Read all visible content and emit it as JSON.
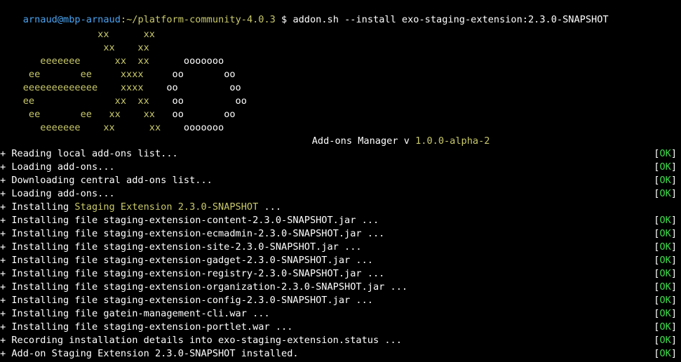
{
  "prompt": {
    "user_host": "arnaud@mbp-arnaud",
    "path": ":~/platform-community-4.0.3",
    "symbol": " $ ",
    "command": "addon.sh --install exo-staging-extension:2.3.0-SNAPSHOT"
  },
  "ascii_art": [
    {
      "e": "                 xx      xx",
      "o": ""
    },
    {
      "e": "                  xx    xx",
      "o": ""
    },
    {
      "e": "       eeeeeee      xx  xx      ",
      "o": "ooooooo"
    },
    {
      "e": "     ee       ee     xxxx     ",
      "o": "oo       oo"
    },
    {
      "e": "    eeeeeeeeeeeee    xxxx    ",
      "o": "oo         oo"
    },
    {
      "e": "    ee              xx  xx    ",
      "o": "oo         oo"
    },
    {
      "e": "     ee       ee   xx    xx   ",
      "o": "oo       oo"
    },
    {
      "e": "       eeeeeee    xx      xx    ",
      "o": "ooooooo"
    }
  ],
  "manager": {
    "title": "Add-ons Manager v ",
    "version": "1.0.0-alpha-2"
  },
  "status": {
    "open": "[",
    "ok": "OK",
    "close": "]"
  },
  "log": [
    {
      "text": "+ Reading local add-ons list...",
      "hl": "",
      "rest": ""
    },
    {
      "text": "+ Loading add-ons...",
      "hl": "",
      "rest": ""
    },
    {
      "text": "+ Downloading central add-ons list...",
      "hl": "",
      "rest": ""
    },
    {
      "text": "+ Loading add-ons...",
      "hl": "",
      "rest": ""
    },
    {
      "text": "+ Installing ",
      "hl": "Staging Extension 2.3.0-SNAPSHOT",
      "rest": " ..."
    },
    {
      "text": "+ Installing file staging-extension-content-2.3.0-SNAPSHOT.jar ...",
      "hl": "",
      "rest": ""
    },
    {
      "text": "+ Installing file staging-extension-ecmadmin-2.3.0-SNAPSHOT.jar ...",
      "hl": "",
      "rest": ""
    },
    {
      "text": "+ Installing file staging-extension-site-2.3.0-SNAPSHOT.jar ...",
      "hl": "",
      "rest": ""
    },
    {
      "text": "+ Installing file staging-extension-gadget-2.3.0-SNAPSHOT.jar ...",
      "hl": "",
      "rest": ""
    },
    {
      "text": "+ Installing file staging-extension-registry-2.3.0-SNAPSHOT.jar ...",
      "hl": "",
      "rest": ""
    },
    {
      "text": "+ Installing file staging-extension-organization-2.3.0-SNAPSHOT.jar ...",
      "hl": "",
      "rest": ""
    },
    {
      "text": "+ Installing file staging-extension-config-2.3.0-SNAPSHOT.jar ...",
      "hl": "",
      "rest": ""
    },
    {
      "text": "+ Installing file gatein-management-cli.war ...",
      "hl": "",
      "rest": ""
    },
    {
      "text": "+ Installing file staging-extension-portlet.war ...",
      "hl": "",
      "rest": ""
    },
    {
      "text": "+ Recording installation details into exo-staging-extension.status ...",
      "hl": "",
      "rest": ""
    },
    {
      "text": "+ Add-on Staging Extension 2.3.0-SNAPSHOT installed.",
      "hl": "",
      "rest": ""
    }
  ],
  "colors": {
    "background": "#000000",
    "prompt_user": "#4aa3f0",
    "highlight": "#c9c96b",
    "ok": "#3ddc4b",
    "text": "#ffffff"
  }
}
